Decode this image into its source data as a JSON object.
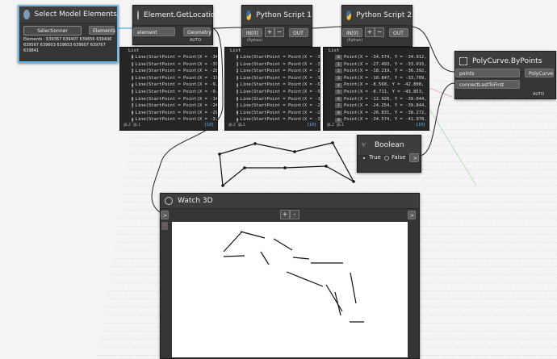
{
  "nodes": {
    "select": {
      "title": "Select Model Elements",
      "button": "Sélectionner",
      "output": "Elements",
      "elements_text": "Elements : 639367 639407 639656 639406 639567 639603 639653 639607 639767 639841"
    },
    "getloc": {
      "title": "Element.GetLocation",
      "input": "element",
      "output": "Geometry",
      "lacing": "AUTO"
    },
    "py1": {
      "title": "Python Script 1",
      "input": "IN[0]",
      "output": "OUT",
      "sub": "(Python)"
    },
    "py2": {
      "title": "Python Script 2",
      "input": "IN[0]",
      "output": "OUT",
      "sub": "(Python)"
    },
    "polycurve": {
      "title": "PolyCurve.ByPoints",
      "in1": "points",
      "in2": "connectLastToFirst",
      "output": "PolyCurve",
      "lacing": "AUTO"
    },
    "bool": {
      "title": "Boolean",
      "true_label": "True",
      "false_label": "False"
    },
    "watch": {
      "title": "Watch 3D"
    }
  },
  "previews": {
    "getloc": {
      "header": "List",
      "rows": [
        "Line(StartPoint = Point(X = -34",
        "Line(StartPoint = Point(X = -33",
        "Line(StartPoint = Point(X = -28",
        "Line(StartPoint = Point(X = -17",
        "Line(StartPoint = Point(X = -9.5",
        "Line(StartPoint = Point(X = -9.5",
        "Line(StartPoint = Point(X = -14",
        "Line(StartPoint = Point(X = -24",
        "Line(StartPoint = Point(X = -29",
        "Line(StartPoint = Point(X = -3."
      ],
      "footer_left": "@L2 @L1",
      "footer_right": "{10}"
    },
    "py1": {
      "header": "List",
      "rows": [
        "Line(StartPoint = Point(X = -34",
        "Line(StartPoint = Point(X = -33",
        "Line(StartPoint = Point(X = -28",
        "Line(StartPoint = Point(X = -17",
        "Line(StartPoint = Point(X = -9.5",
        "Line(StartPoint = Point(X = -9.5",
        "Line(StartPoint = Point(X = -14",
        "Line(StartPoint = Point(X = -24",
        "Line(StartPoint = Point(X = -29",
        "Line(StartPoint = Point(X = -3."
      ],
      "footer_left": "@L2 @L1",
      "footer_right": "{10}"
    },
    "py2": {
      "header": "List",
      "rows": [
        "Point(X = -34.574, Y = -34.912,",
        "Point(X = -27.493, Y = -33.015,",
        "Point(X = -18.219, Y = -36.392,",
        "Point(X = -10.847, Y = -33.709,",
        "Point(X = -8.560, Y = -42.808,",
        "Point(X = -8.711, Y = -43.853,",
        "Point(X = -12.920, Y = -39.044,",
        "Point(X = -24.254, Y = -39.844,",
        "Point(X = -26.831, Y = -38.272,",
        "Point(X = -34.574, Y = -41.978,"
      ],
      "footer_left": "@L2 @L1",
      "footer_right": "{10}"
    }
  },
  "watch_buttons": {
    "zoom_in": "+",
    "zoom_out": "-",
    "left_port": ">",
    "right_port": ">"
  },
  "icons": {
    "select": "cursor-select-icon",
    "getloc": "location-icon",
    "python": "python-icon",
    "polycurve": "polycurve-icon",
    "bool": "boolean-icon",
    "watch": "watch-icon"
  },
  "colors": {
    "canvas_bg": "#f5f5f5",
    "node_body": "#353535",
    "selected_border": "#6ab7e8",
    "wire": "#222222"
  }
}
